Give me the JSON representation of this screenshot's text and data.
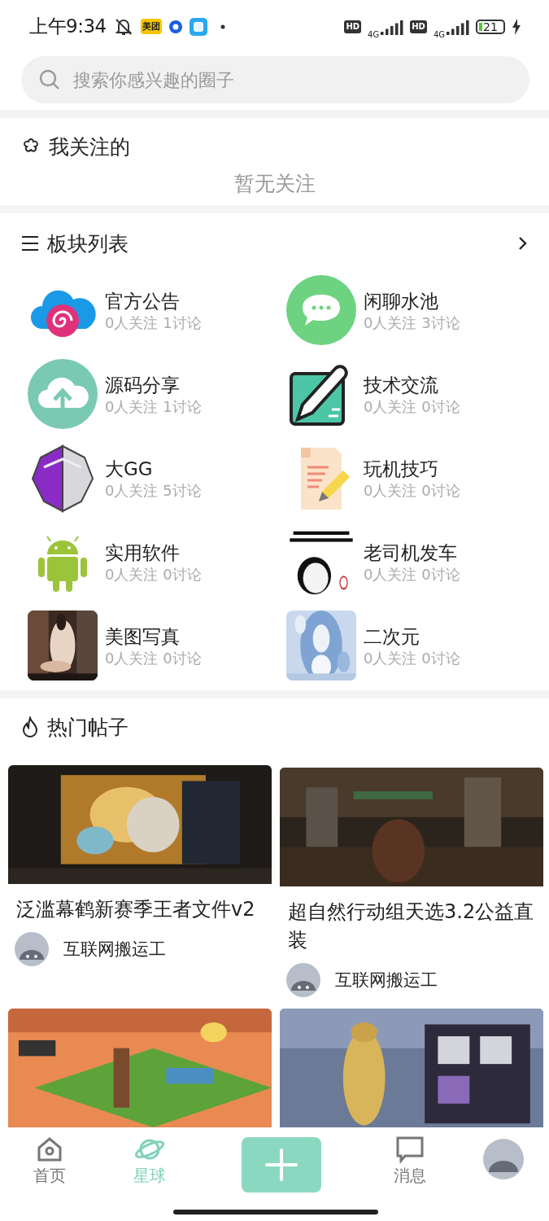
{
  "status_bar": {
    "time": "上午9:34",
    "app_badge": "美团",
    "hd_1": "HD",
    "network_1": "4G",
    "hd_2": "HD",
    "network_2": "4G",
    "battery": "21"
  },
  "search": {
    "placeholder": "搜索你感兴趣的圈子"
  },
  "following": {
    "title": "我关注的",
    "empty_text": "暂无关注"
  },
  "boards": {
    "title": "板块列表",
    "items": [
      {
        "kind": "icon",
        "name": "官方公告",
        "stats": "0人关注 1讨论"
      },
      {
        "kind": "icon",
        "name": "闲聊水池",
        "stats": "0人关注 3讨论"
      },
      {
        "kind": "icon",
        "name": "源码分享",
        "stats": "0人关注 1讨论"
      },
      {
        "kind": "icon",
        "name": "技术交流",
        "stats": "0人关注 0讨论"
      },
      {
        "kind": "icon",
        "name": "大GG",
        "stats": "0人关注 5讨论"
      },
      {
        "kind": "icon",
        "name": "玩机技巧",
        "stats": "0人关注 0讨论"
      },
      {
        "kind": "icon",
        "name": "实用软件",
        "stats": "0人关注 0讨论"
      },
      {
        "kind": "picture",
        "name": "老司机发车",
        "stats": "0人关注 0讨论"
      },
      {
        "kind": "picture",
        "name": "美图写真",
        "stats": "0人关注 0讨论"
      },
      {
        "kind": "picture",
        "name": "二次元",
        "stats": "0人关注 0讨论"
      }
    ]
  },
  "hot_posts": {
    "title": "热门帖子",
    "posts": [
      {
        "kind": "post",
        "title": "泛滥幕鹤新赛季王者文件v2",
        "author": "互联网搬运工"
      },
      {
        "kind": "post",
        "title": "超自然行动组天选3.2公益直装",
        "author": "互联网搬运工"
      },
      {
        "kind": "picture"
      },
      {
        "kind": "picture"
      }
    ]
  },
  "tab_bar": {
    "items": [
      {
        "kind": "home",
        "label": "首页",
        "selected": false
      },
      {
        "kind": "planet",
        "label": "星球",
        "selected": true
      },
      {
        "kind": "add"
      },
      {
        "kind": "message",
        "label": "消息",
        "selected": false
      },
      {
        "kind": "avatar"
      }
    ]
  }
}
